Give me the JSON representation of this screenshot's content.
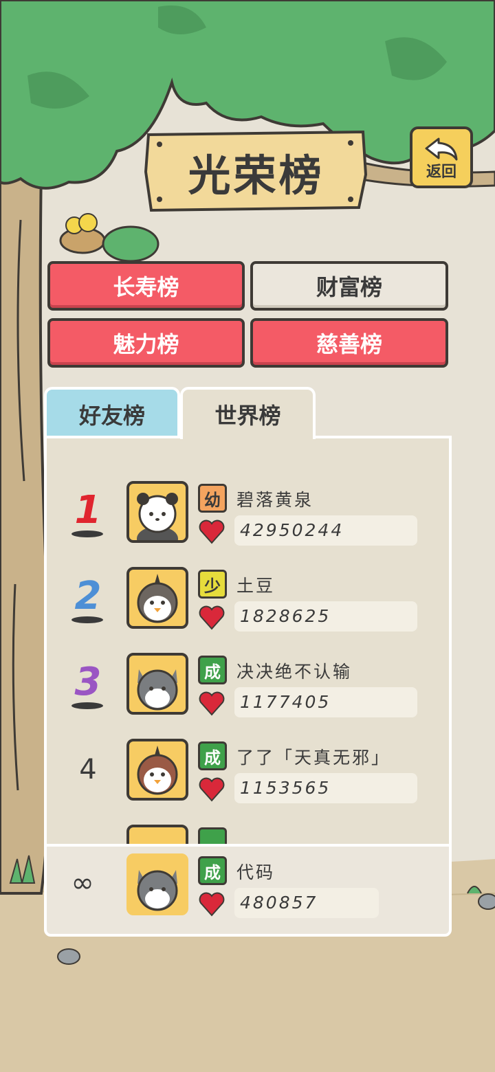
{
  "header": {
    "title": "光荣榜",
    "back_label": "返回"
  },
  "categories": [
    {
      "label": "长寿榜",
      "selected": false
    },
    {
      "label": "财富榜",
      "selected": true
    },
    {
      "label": "魅力榜",
      "selected": false
    },
    {
      "label": "慈善榜",
      "selected": false
    }
  ],
  "tabs": [
    {
      "label": "好友榜",
      "active": false
    },
    {
      "label": "世界榜",
      "active": true
    }
  ],
  "leaderboard": [
    {
      "rank": "1",
      "badge": "幼",
      "badge_color": "#f4a45f",
      "name": "碧落黄泉",
      "score": "42950244",
      "avatar": "panda-avatar-icon"
    },
    {
      "rank": "2",
      "badge": "少",
      "badge_color": "#e6dc3c",
      "name": "土豆",
      "score": "1828625",
      "avatar": "penguin-avatar-icon"
    },
    {
      "rank": "3",
      "badge": "成",
      "badge_color": "#3fa14a",
      "name": "决决绝不认输",
      "score": "1177405",
      "avatar": "cat-avatar-icon"
    },
    {
      "rank": "4",
      "badge": "成",
      "badge_color": "#3fa14a",
      "name": "了了「天真无邪」",
      "score": "1153565",
      "avatar": "bird-avatar-icon"
    }
  ],
  "my_entry": {
    "rank": "∞",
    "badge": "成",
    "badge_color": "#3fa14a",
    "name": "代码",
    "score": "480857",
    "avatar": "cat-avatar-icon"
  },
  "colors": {
    "accent_red": "#f45b66",
    "sky_tab": "#a6dbe8",
    "rank1": "#e0252f",
    "rank2": "#4d8fd6",
    "rank3": "#9a55c3",
    "heart": "#d9283a"
  }
}
